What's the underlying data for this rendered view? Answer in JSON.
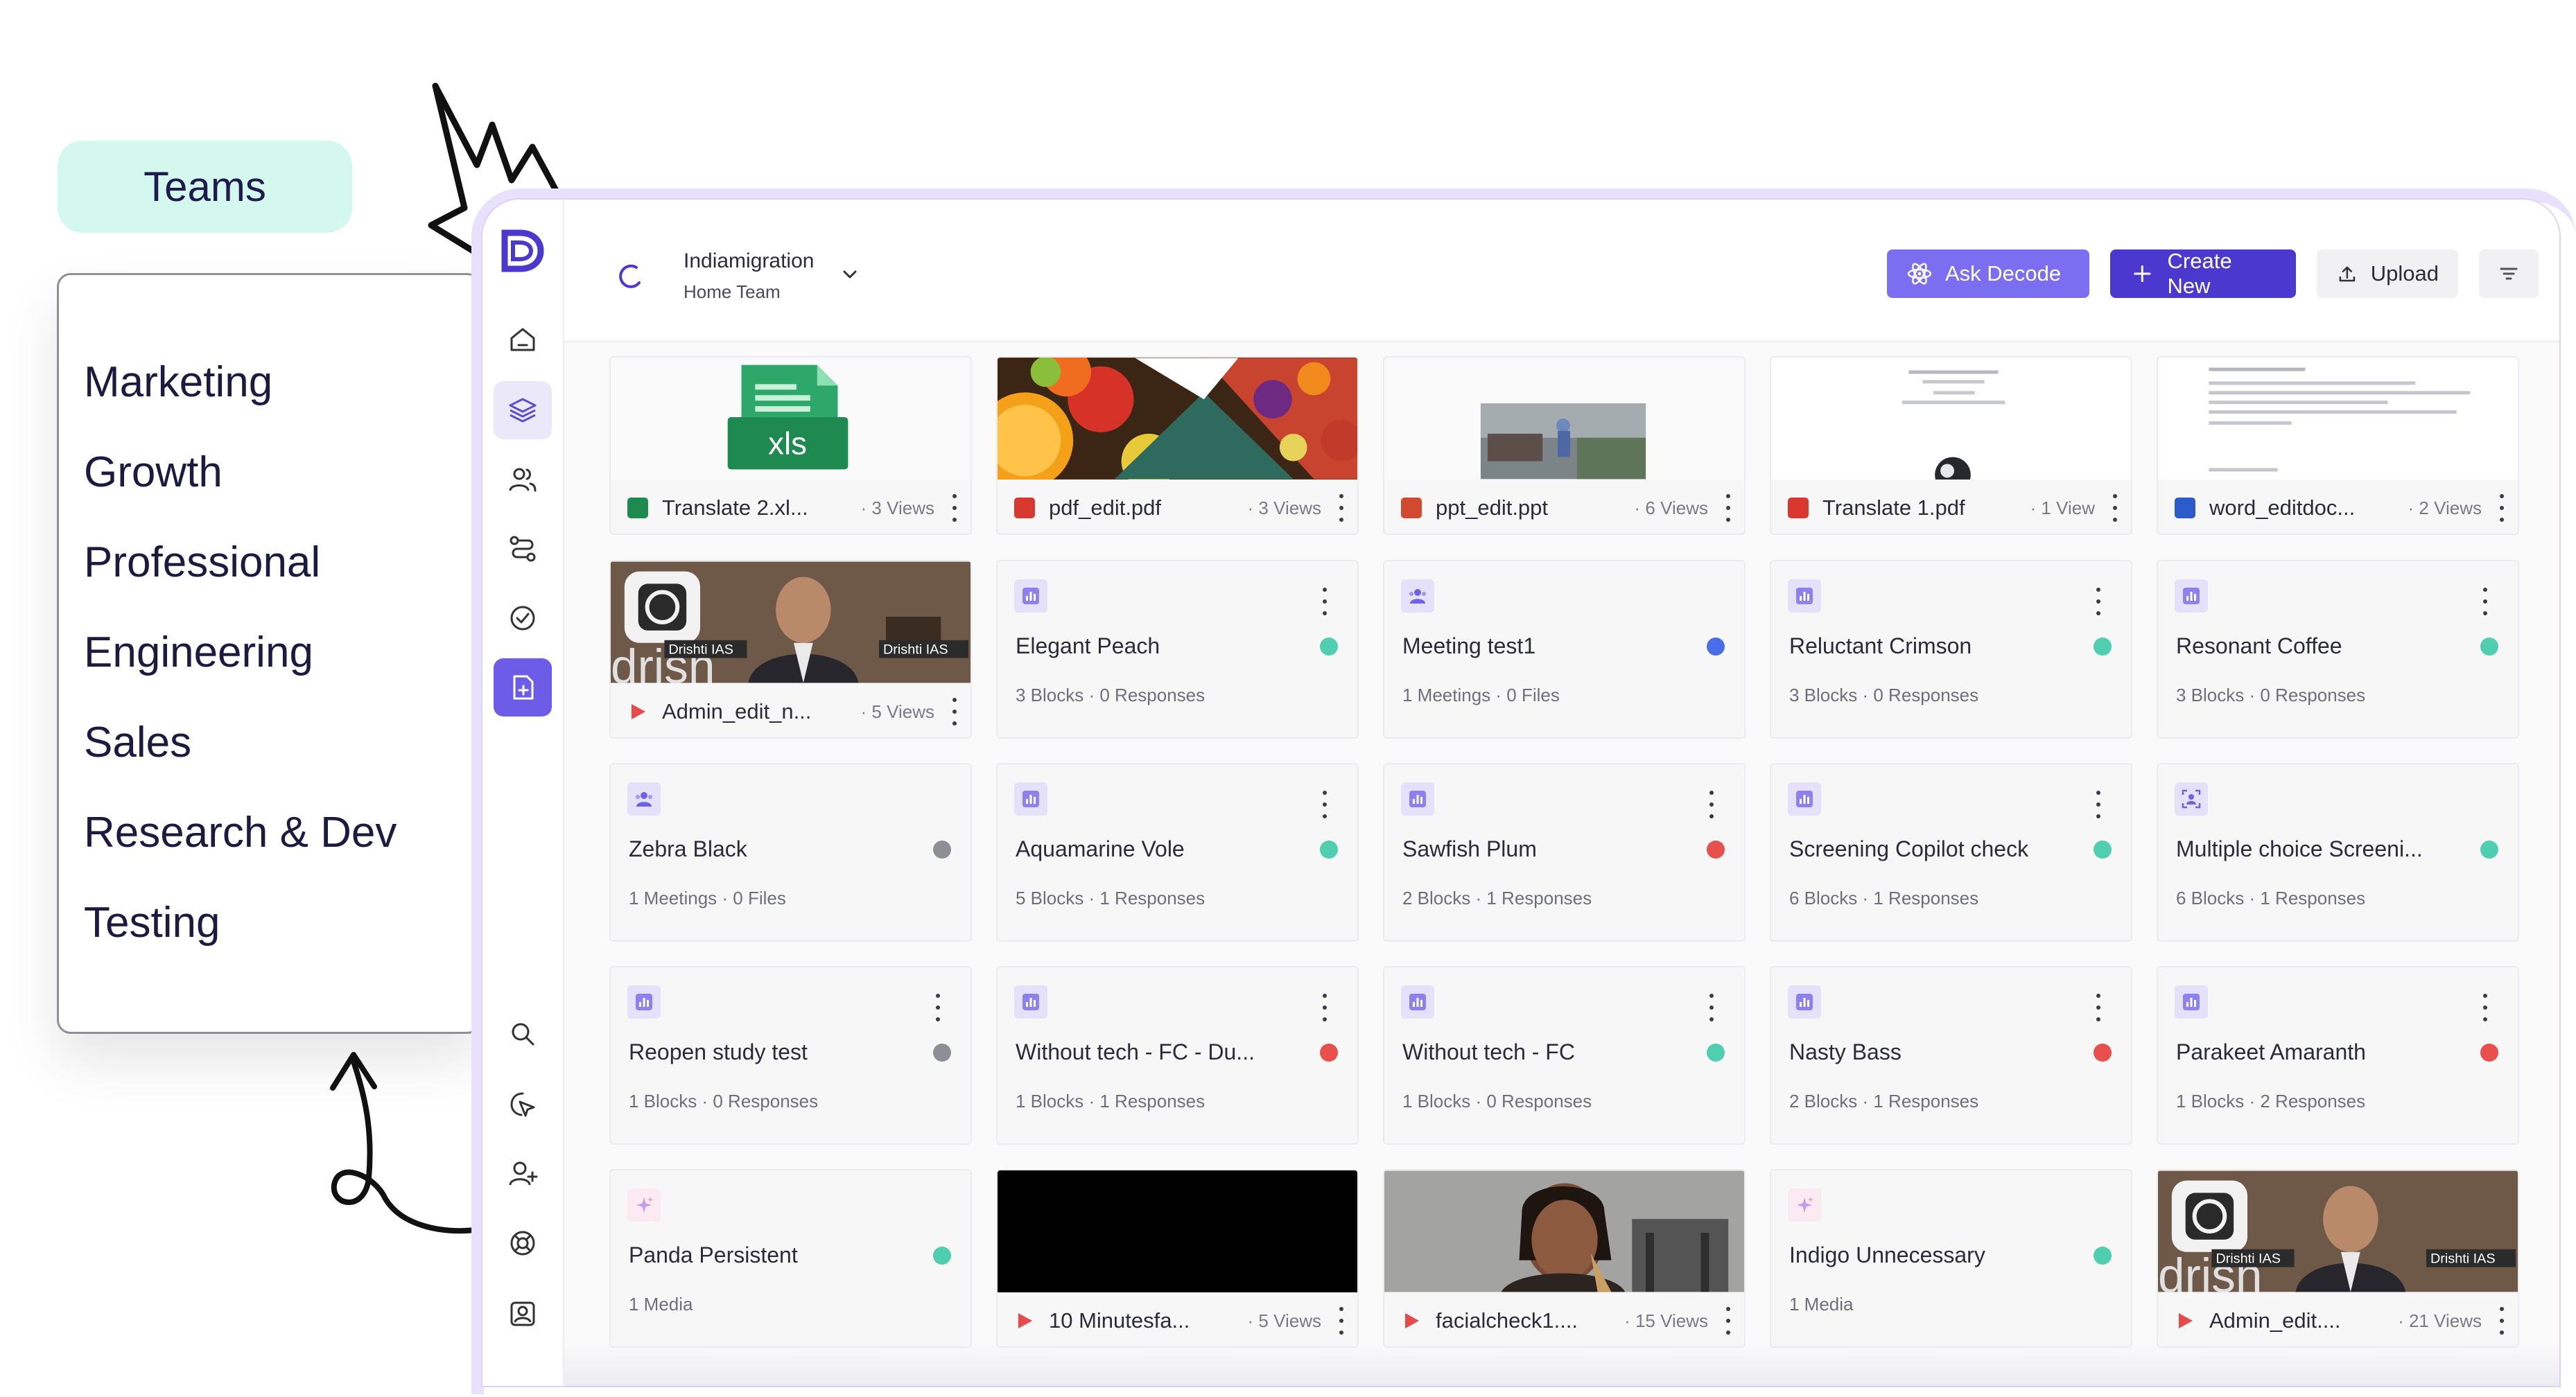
{
  "teams_panel": {
    "title": "Teams",
    "items": [
      "Marketing",
      "Growth",
      "Professional",
      "Engineering",
      "Sales",
      "Research & Dev",
      "Testing"
    ]
  },
  "colors": {
    "brand": "#4b39cf",
    "accent": "#7b6ef0",
    "teams_pill": "#d4f8ee",
    "status_green": "#4fcfb0",
    "status_red": "#e8504d",
    "status_gray": "#8e8e96",
    "status_blue": "#4a6ee8"
  },
  "sidebar": {
    "icons": [
      "logo-icon",
      "home-icon",
      "layers-icon",
      "users-icon",
      "route-icon",
      "check-circle-icon",
      "new-document-icon",
      "search-icon",
      "cursor-click-icon",
      "add-user-icon",
      "help-buoy-icon",
      "profile-card-icon"
    ]
  },
  "header": {
    "workspace_name": "Indiamigration",
    "team_name": "Home Team",
    "ask_label": "Ask Decode",
    "create_label": "Create New",
    "upload_label": "Upload"
  },
  "files": [
    {
      "name": "Translate 2.xl...",
      "views": "· 3 Views",
      "type": "xls"
    },
    {
      "name": "pdf_edit.pdf",
      "views": "· 3 Views",
      "type": "pdf"
    },
    {
      "name": "ppt_edit.ppt",
      "views": "· 6 Views",
      "type": "ppt"
    },
    {
      "name": "Translate 1.pdf",
      "views": "· 1 View",
      "type": "pdf"
    },
    {
      "name": "word_editdoc...",
      "views": "· 2 Views",
      "type": "doc"
    },
    {
      "name": "Admin_edit_n...",
      "views": "· 5 Views",
      "type": "video"
    },
    {
      "name": "10 Minutesfa...",
      "views": "· 5 Views",
      "type": "video"
    },
    {
      "name": "facialcheck1....",
      "views": "· 15 Views",
      "type": "video"
    },
    {
      "name": "Admin_edit....",
      "views": "· 21 Views",
      "type": "video"
    }
  ],
  "thumb_labels": {
    "xls": "xls",
    "drishti": "Drishti IAS"
  },
  "items": [
    {
      "title": "Elegant Peach",
      "meta": "3  Blocks  ·  0  Responses",
      "status": "green",
      "icon": "chart-icon"
    },
    {
      "title": "Meeting test1",
      "meta": "1  Meetings  ·  0  Files",
      "status": "blue",
      "icon": "meeting-icon"
    },
    {
      "title": "Reluctant Crimson",
      "meta": "3  Blocks  ·  0  Responses",
      "status": "green",
      "icon": "chart-icon"
    },
    {
      "title": "Resonant Coffee",
      "meta": "3  Blocks  ·  0  Responses",
      "status": "green",
      "icon": "chart-icon"
    },
    {
      "title": "Zebra Black",
      "meta": "1  Meetings  ·  0  Files",
      "status": "gray",
      "icon": "meeting-icon"
    },
    {
      "title": "Aquamarine Vole",
      "meta": "5  Blocks  ·  1  Responses",
      "status": "green",
      "icon": "chart-icon"
    },
    {
      "title": "Sawfish Plum",
      "meta": "2  Blocks  ·  1  Responses",
      "status": "red",
      "icon": "chart-icon"
    },
    {
      "title": "Screening Copilot check",
      "meta": "6  Blocks  ·  1  Responses",
      "status": "green",
      "icon": "chart-icon"
    },
    {
      "title": "Multiple choice Screeni...",
      "meta": "6  Blocks  ·  1  Responses",
      "status": "green",
      "icon": "screening-icon"
    },
    {
      "title": "Reopen study test",
      "meta": "1  Blocks  ·  0  Responses",
      "status": "gray",
      "icon": "chart-icon"
    },
    {
      "title": "Without tech - FC - Du...",
      "meta": "1  Blocks  ·  1  Responses",
      "status": "red",
      "icon": "chart-icon"
    },
    {
      "title": "Without tech - FC",
      "meta": "1  Blocks  ·  0  Responses",
      "status": "green",
      "icon": "chart-icon"
    },
    {
      "title": "Nasty Bass",
      "meta": "2  Blocks  ·  1  Responses",
      "status": "red",
      "icon": "chart-icon"
    },
    {
      "title": "Parakeet Amaranth",
      "meta": "1  Blocks  ·  2  Responses",
      "status": "red",
      "icon": "chart-icon"
    },
    {
      "title": "Panda Persistent",
      "meta": "1  Media",
      "status": "green",
      "icon": "sparkle-icon"
    },
    {
      "title": "Indigo Unnecessary",
      "meta": "1  Media",
      "status": "green",
      "icon": "sparkle-icon"
    }
  ]
}
